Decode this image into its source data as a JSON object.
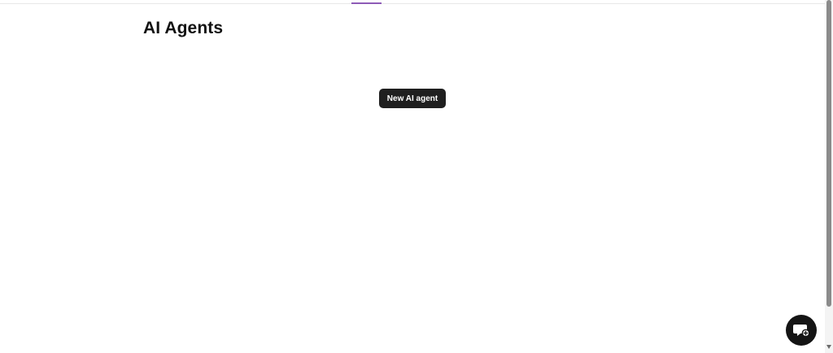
{
  "header": {
    "title": "AI Agents"
  },
  "main": {
    "new_agent_label": "New AI agent"
  },
  "chat": {
    "icon": "chat-bubble-add-icon"
  },
  "colors": {
    "tab_indicator": "#8e5bb6",
    "button_bg": "#1f1f1f",
    "launcher_bg": "#141414"
  }
}
